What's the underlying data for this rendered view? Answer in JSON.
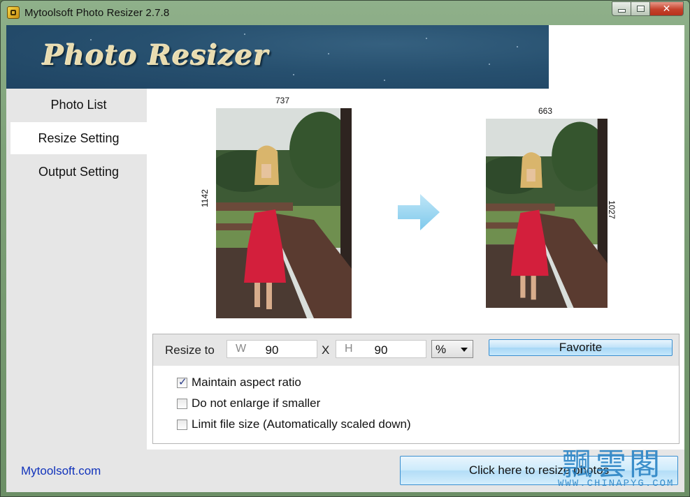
{
  "window": {
    "title": "Mytoolsoft Photo Resizer 2.7.8",
    "controls": {
      "minimize": "minimize",
      "maximize": "maximize",
      "close": "✕"
    }
  },
  "banner": {
    "title": "Photo Resizer"
  },
  "sidebar": {
    "items": [
      {
        "label": "Photo List",
        "active": false
      },
      {
        "label": "Resize Setting",
        "active": true
      },
      {
        "label": "Output Setting",
        "active": false
      }
    ],
    "link": "Mytoolsoft.com"
  },
  "preview": {
    "original": {
      "width": "737",
      "height": "1142"
    },
    "resized": {
      "width": "663",
      "height": "1027"
    },
    "arrow_icon": "right-arrow-icon"
  },
  "resize": {
    "label": "Resize to",
    "width_prefix": "W",
    "width_value": "90",
    "separator": "X",
    "height_prefix": "H",
    "height_value": "90",
    "unit": "%",
    "favorite_label": "Favorite",
    "options": [
      {
        "label": "Maintain aspect ratio",
        "checked": true
      },
      {
        "label": "Do not enlarge if smaller",
        "checked": false
      },
      {
        "label": "Limit file size (Automatically scaled down)",
        "checked": false
      }
    ]
  },
  "action": {
    "resize_label": "Click here to resize photos"
  },
  "watermark": {
    "cn": "飄雲閣",
    "en": "WWW.CHINAPYG.COM"
  },
  "colors": {
    "accent": "#3a8fd0",
    "banner": "#27506f",
    "link": "#1133bb"
  }
}
